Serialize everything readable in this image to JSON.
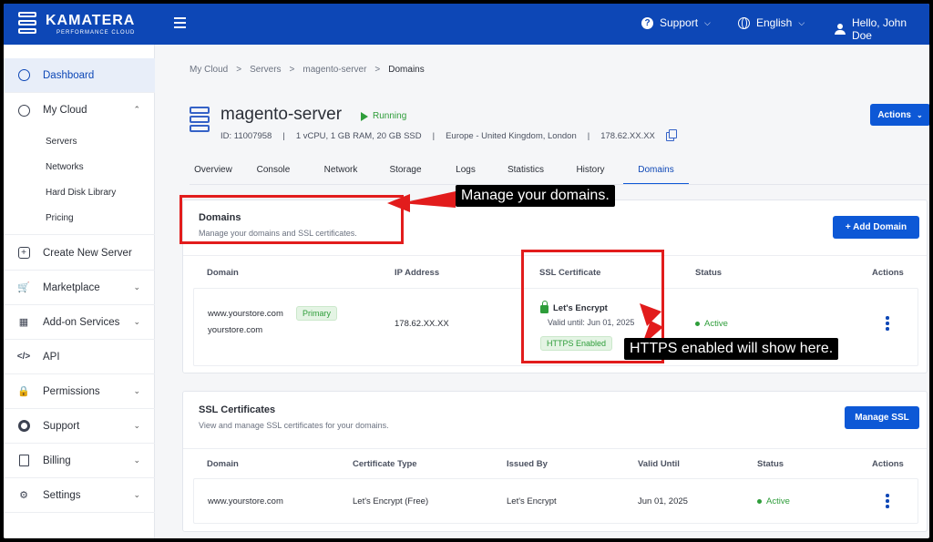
{
  "topbar": {
    "brand_name": "KAMATERA",
    "brand_tagline": "PERFORMANCE CLOUD",
    "support_label": "Support",
    "language_label": "English",
    "user_label": "Hello, John Doe"
  },
  "sidebar": {
    "dashboard": "Dashboard",
    "my_cloud": "My Cloud",
    "sub_items": [
      "Servers",
      "Networks",
      "Hard Disk Library",
      "Pricing"
    ],
    "create_server": "Create New Server",
    "marketplace": "Marketplace",
    "addon_services": "Add-on Services",
    "api": "API",
    "permissions": "Permissions",
    "support": "Support",
    "billing": "Billing",
    "settings": "Settings"
  },
  "breadcrumb": [
    "My Cloud",
    "Servers",
    "magento-server",
    "Domains"
  ],
  "breadcrumb_sep": ">",
  "server": {
    "name": "magento-server",
    "status": "Running",
    "id": "ID: 11007958",
    "specs": "1 vCPU, 1 GB RAM, 20 GB SSD",
    "location": "Europe - United Kingdom, London",
    "ip": "178.62.XX.XX",
    "separator": "|"
  },
  "actions_button": "Actions",
  "tabs": [
    "Overview",
    "Console",
    "Network",
    "Storage",
    "Logs",
    "Statistics",
    "History",
    "Domains"
  ],
  "active_tab": "Domains",
  "domains_card": {
    "title": "Domains",
    "subtitle": "Manage your domains and SSL certificates.",
    "add_button": "+ Add Domain",
    "columns": [
      "Domain",
      "IP Address",
      "SSL Certificate",
      "Status",
      "Actions"
    ],
    "row": {
      "domain": "www.yourstore.com",
      "badge": "Primary",
      "alias": "yourstore.com",
      "ip": "178.62.XX.XX",
      "ssl_name": "Let's Encrypt",
      "ssl_valid": "Valid until: Jun 01, 2025",
      "https_badge": "HTTPS Enabled",
      "status": "Active"
    }
  },
  "ssl_card": {
    "title": "SSL Certificates",
    "subtitle": "View and manage SSL certificates for your domains.",
    "manage_button": "Manage SSL",
    "columns": [
      "Domain",
      "Certificate Type",
      "Issued By",
      "Valid Until",
      "Status",
      "Actions"
    ],
    "row": {
      "domain": "www.yourstore.com",
      "type": "Let's Encrypt (Free)",
      "issuer": "Let's Encrypt",
      "valid_until": "Jun 01, 2025",
      "status": "Active"
    }
  },
  "annotations": {
    "domains_callout": "Manage your domains.",
    "https_callout": "HTTPS enabled will show here.",
    "color": "#e21c1c"
  },
  "colors": {
    "brand_blue": "#0d47b6",
    "button_blue": "#0d58d6",
    "success_green": "#2e9d3a"
  }
}
